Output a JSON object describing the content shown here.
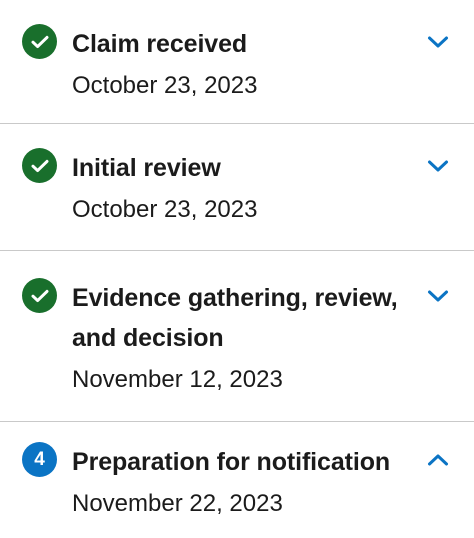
{
  "steps": [
    {
      "title": "Claim received",
      "date": "October 23, 2023",
      "status": "complete",
      "expanded": false
    },
    {
      "title": "Initial review",
      "date": "October 23, 2023",
      "status": "complete",
      "expanded": false
    },
    {
      "title": "Evidence gathering, review, and decision",
      "date": "November 12, 2023",
      "status": "complete",
      "expanded": false
    },
    {
      "title": "Preparation for notification",
      "date": "November 22, 2023",
      "status": "current",
      "number": "4",
      "expanded": true
    }
  ],
  "colors": {
    "complete": "#196f2c",
    "current": "#0b74c4",
    "chevron": "#0b74c4",
    "divider": "#c9c9c9",
    "text": "#1b1b1b"
  },
  "icons": {
    "complete": "checkmark-icon",
    "collapsed": "chevron-down-icon",
    "expanded": "chevron-up-icon"
  }
}
